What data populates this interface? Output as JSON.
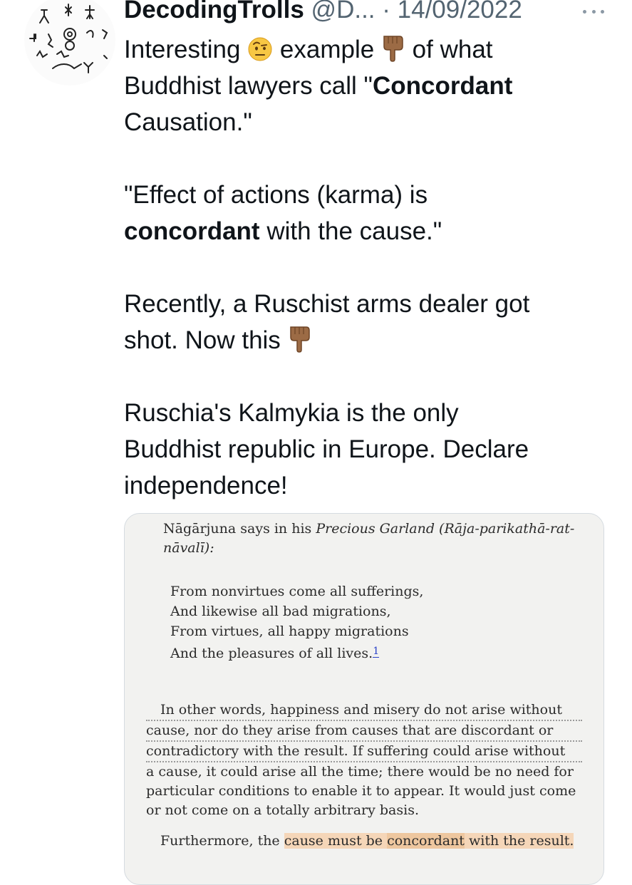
{
  "tweet": {
    "display_name": "DecodingTrolls",
    "handle": "@D...",
    "separator": "·",
    "date": "14/09/2022",
    "lines": {
      "p1_a": "Interesting",
      "p1_b": "example",
      "p1_c": "of what",
      "p1_d": "Buddhist lawyers call \"",
      "p1_bold": "Concordant",
      "p1_e": "Causation.\"",
      "p2_a": "\"Effect of actions (karma) is",
      "p2_bold": "concordant",
      "p2_b": "with the cause.\"",
      "p3_a": "Recently, a Ruschist arms dealer got",
      "p3_b": "shot. Now this",
      "p4_a": "Ruschia's Kalmykia is the only",
      "p4_b": "Buddhist republic in Europe. Declare",
      "p4_c": "independence!"
    },
    "emojis": [
      "face-with-raised-eyebrow-emoji",
      "backhand-index-pointing-down-emoji"
    ]
  },
  "book_page": {
    "intro_1": "Nāgārjuna says in his ",
    "intro_title": "Precious Garland (Rāja-parikathā-rat-",
    "intro_2": "nāvalī):",
    "verse": [
      "From nonvirtues come all sufferings,",
      "And likewise all bad migrations,",
      "From virtues, all happy migrations",
      "And the pleasures of all lives."
    ],
    "footnote": "1",
    "paragraph": [
      "In other words, happiness and misery do not arise without",
      "cause, nor do they arise from causes that are discordant or",
      "contradictory with the result. If suffering could arise without",
      "a cause, it could arise all the time; there would be no need for",
      "particular conditions to enable it to appear. It would just come",
      "or not come on a totally arbitrary basis."
    ],
    "last_a": "Furthermore, the ",
    "last_hl1": "cause must be ",
    "last_hl2": "concordant",
    "last_hl3": " with the result."
  },
  "colors": {
    "text": "#0f1419",
    "secondary": "#536471",
    "highlight": "#f5d6b8"
  }
}
